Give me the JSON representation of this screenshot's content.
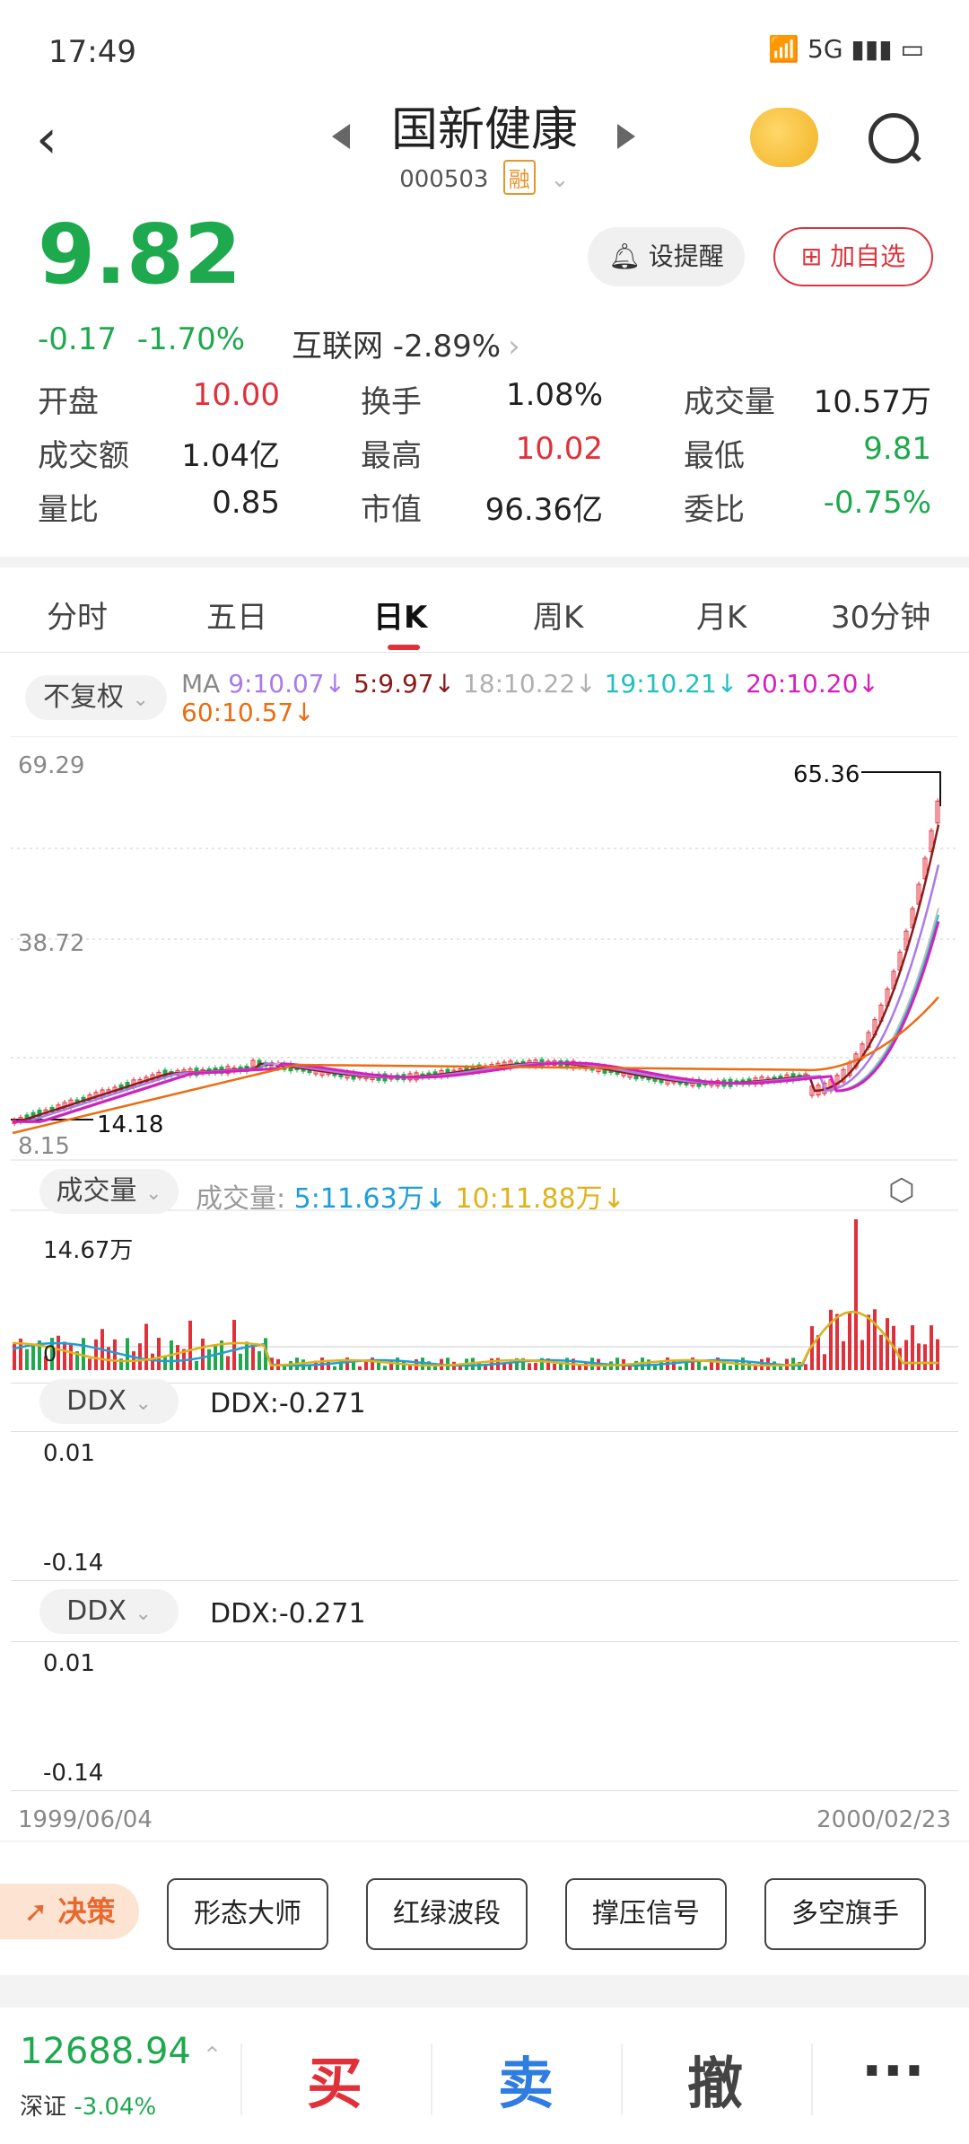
{
  "status": {
    "time": "17:49",
    "icons": "📶 5G ▮▮▮ ▭"
  },
  "header": {
    "title": "国新健康",
    "code": "000503",
    "badge": "融"
  },
  "quote": {
    "price": "9.82",
    "change": "-0.17",
    "change_pct": "-1.70%",
    "sector": "互联网 -2.89%",
    "alert_label": "设提醒",
    "fav_label": "加自选"
  },
  "stats": [
    {
      "label": "开盘",
      "value": "10.00",
      "color": "#e0313b"
    },
    {
      "label": "换手",
      "value": "1.08%",
      "color": "#222222"
    },
    {
      "label": "成交量",
      "value": "10.57万",
      "color": "#222222"
    },
    {
      "label": "成交额",
      "value": "1.04亿",
      "color": "#222222"
    },
    {
      "label": "最高",
      "value": "10.02",
      "color": "#e0313b"
    },
    {
      "label": "最低",
      "value": "9.81",
      "color": "#1ea94e"
    },
    {
      "label": "量比",
      "value": "0.85",
      "color": "#222222"
    },
    {
      "label": "市值",
      "value": "96.36亿",
      "color": "#222222"
    },
    {
      "label": "委比",
      "value": "-0.75%",
      "color": "#1ea94e"
    }
  ],
  "tabs": [
    "分时",
    "五日",
    "日K",
    "周K",
    "月K",
    "30分钟"
  ],
  "active_tab": "日K",
  "adjust": "不复权",
  "ma": {
    "prefix": "MA",
    "ma9": "9:10.07↓",
    "ma5": "5:9.97↓",
    "ma18": "18:10.22↓",
    "ma19": "19:10.21↓",
    "ma20": "20:10.20↓",
    "ma60": "60:10.57↓"
  },
  "price_axis": {
    "top": "69.29",
    "mid": "38.72",
    "bottom": "8.15"
  },
  "price_markers": {
    "high": "65.36",
    "low": "14.18"
  },
  "volume": {
    "pill": "成交量",
    "label": "成交量:",
    "v5": "5:11.63万↓",
    "v10": "10:11.88万↓",
    "max": "14.67万",
    "zero": "0"
  },
  "ddx": [
    {
      "pill": "DDX",
      "value": "DDX:-0.271",
      "top": "0.01",
      "bottom": "-0.14"
    },
    {
      "pill": "DDX",
      "value": "DDX:-0.271",
      "top": "0.01",
      "bottom": "-0.14"
    }
  ],
  "dates": {
    "start": "1999/06/04",
    "end": "2000/02/23"
  },
  "tools": {
    "decide": "决策",
    "items": [
      "形态大师",
      "红绿波段",
      "撑压信号",
      "多空旗手"
    ]
  },
  "bottom": {
    "index_value": "12688.94",
    "index_name": "深证",
    "index_change": "-3.04%",
    "buy": "买",
    "sell": "卖",
    "cancel": "撤",
    "more": "···"
  },
  "colors": {
    "up": "#e0313b",
    "down": "#1ea94e",
    "ma5": "#8b1a1a",
    "ma9": "#a97bea",
    "ma18": "#c0c0c0",
    "ma19": "#21c1c0",
    "ma20": "#d61fbd",
    "ma60": "#ec6c12"
  }
}
